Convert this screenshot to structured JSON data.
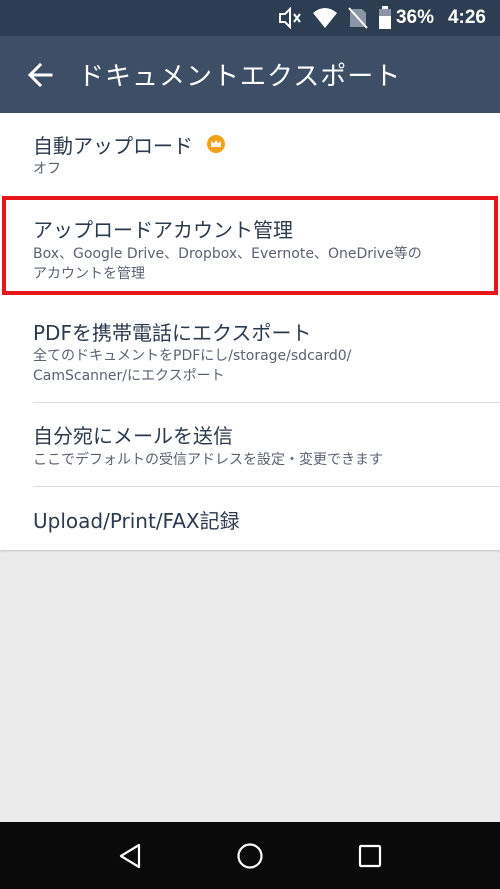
{
  "status_bar": {
    "battery_percent": "36%",
    "time": "4:26",
    "icons": [
      "mute-icon",
      "wifi-icon",
      "no-sim-icon",
      "battery-icon"
    ]
  },
  "app_bar": {
    "title": "ドキュメントエクスポート",
    "back_icon": "arrow-left-icon"
  },
  "settings": [
    {
      "title": "自動アップロード",
      "subtitle": "オフ",
      "premium_icon": "crown-icon"
    },
    {
      "title": "アップロードアカウント管理",
      "subtitle": "Box、Google Drive、Dropbox、Evernote、OneDrive等のアカウントを管理",
      "subtitle_line1": "Box、Google Drive、Dropbox、Evernote、OneDrive等の",
      "subtitle_line2": "アカウントを管理",
      "highlighted": true
    },
    {
      "title": "PDFを携帯電話にエクスポート",
      "subtitle_line1": "全てのドキュメントをPDFにし/storage/sdcard0/",
      "subtitle_line2": "CamScanner/にエクスポート"
    },
    {
      "title": "自分宛にメールを送信",
      "subtitle": "ここでデフォルトの受信アドレスを設定・変更できます"
    },
    {
      "title": "Upload/Print/FAX記録"
    }
  ],
  "colors": {
    "status_bar": "#2e3e52",
    "app_bar": "#3c4f66",
    "highlight": "#e8161b",
    "crown": "#f0a21b",
    "nav_bar": "#0a0a0a"
  },
  "nav_bar": {
    "icons": [
      "back-triangle-icon",
      "home-circle-icon",
      "recents-square-icon"
    ]
  }
}
